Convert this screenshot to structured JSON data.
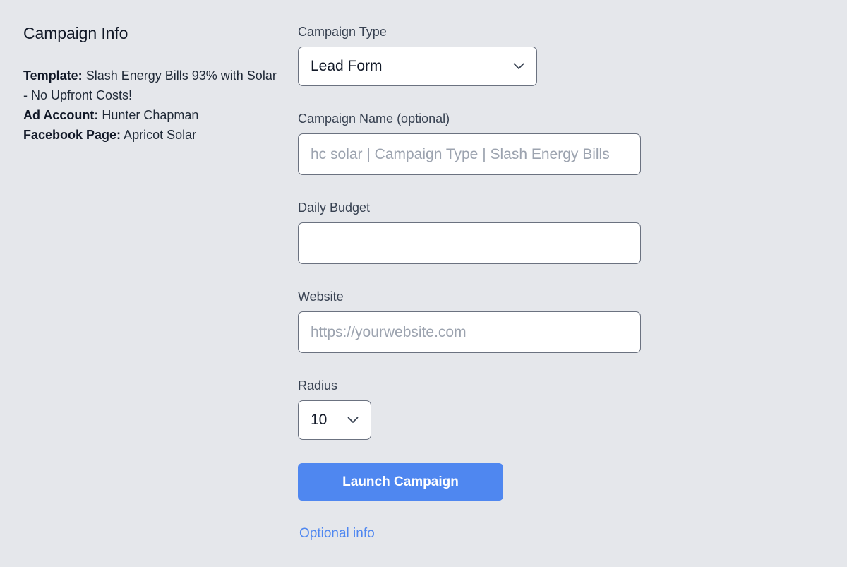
{
  "info": {
    "title": "Campaign Info",
    "template_label": "Template:",
    "template_value": "Slash Energy Bills 93% with Solar - No Upfront Costs!",
    "ad_account_label": "Ad Account:",
    "ad_account_value": "Hunter Chapman",
    "facebook_page_label": "Facebook Page:",
    "facebook_page_value": "Apricot Solar"
  },
  "form": {
    "campaign_type": {
      "label": "Campaign Type",
      "value": "Lead Form"
    },
    "campaign_name": {
      "label": "Campaign Name (optional)",
      "placeholder": "hc solar | Campaign Type | Slash Energy Bills"
    },
    "daily_budget": {
      "label": "Daily Budget",
      "value": ""
    },
    "website": {
      "label": "Website",
      "placeholder": "https://yourwebsite.com"
    },
    "radius": {
      "label": "Radius",
      "value": "10"
    },
    "launch_label": "Launch Campaign",
    "optional_info_label": "Optional info"
  },
  "icons": {
    "select_arrow": "chevron-down-icon"
  },
  "colors": {
    "background": "#e5e7eb",
    "accent": "#4f87f0",
    "border": "#6b7280",
    "placeholder": "#9ca3af"
  }
}
